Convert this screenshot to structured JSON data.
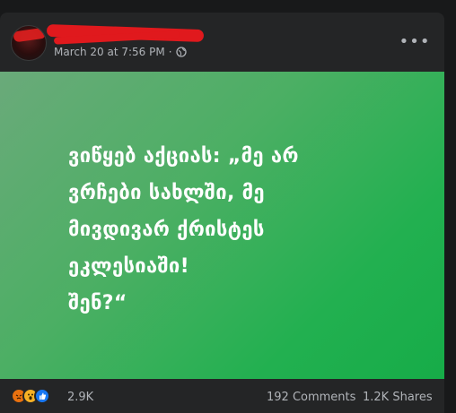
{
  "post": {
    "author_name_redacted": true,
    "timestamp": "March 20 at 7:56 PM",
    "separator": "·",
    "privacy_icon": "globe-icon",
    "more_label": "•••",
    "image_text": "ვიწყებ აქციას: „მე არ\nვრჩები სახლში, მე\nმივდივარ ქრისტეს\nეკლესიაში!\nშენ?“",
    "image_gradient": [
      "#6aaa7a",
      "#16ac48"
    ]
  },
  "footer": {
    "reactions": [
      "angry-reaction-icon",
      "wow-reaction-icon",
      "like-reaction-icon"
    ],
    "reaction_count": "2.9K",
    "comments": "192 Comments",
    "shares": "1.2K Shares"
  },
  "colors": {
    "background": "#18191a",
    "card": "#242526",
    "secondary_text": "#b0b3b8",
    "redaction": "#e0191d"
  }
}
